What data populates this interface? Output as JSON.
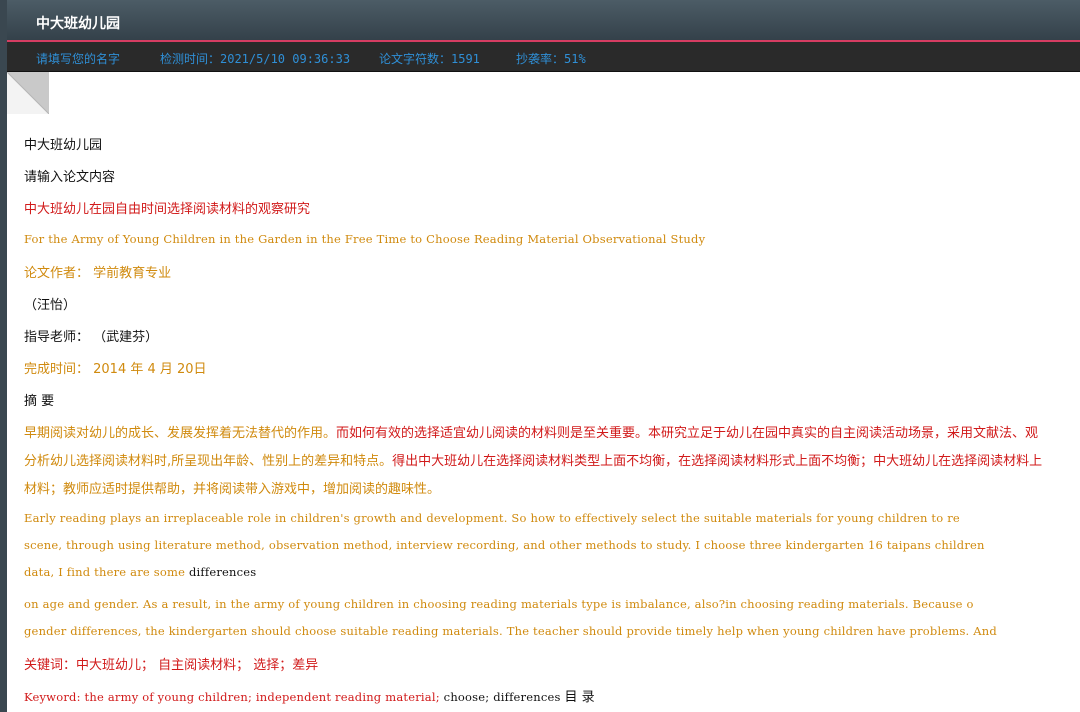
{
  "window": {
    "title": "中大班幼儿园"
  },
  "infobar": {
    "name_prompt": "请填写您的名字",
    "check_time": "检测时间：2021/5/10 09:36:33",
    "char_count": "论文字符数：1591",
    "plagiarism_rate": "抄袭率：51%"
  },
  "document": {
    "lines": [
      "中大班幼儿园",
      "请输入论文内容",
      "中大班幼儿在园自由时间选择阅读材料的观察研究",
      "For the Army of Young Children in the Garden in the Free Time to Choose Reading Material Observational Study",
      "论文作者： 学前教育专业",
      "（汪怡）",
      "指导老师：  （武建芬）",
      "完成时间： 2014 年 4 月 20日",
      "摘 要",
      "早期阅读对幼儿的成长、发展发挥着无法替代的作用。",
      "而如何有效的选择适宜幼儿阅读的材料则是至关重要。本研究立足于幼儿在园中真实的自主阅读活动场景，采用文献法、观",
      "分析幼儿选择阅读材料时,所呈现出年龄、性别上的差异和特点。",
      "得出中大班幼儿在选择阅读材料类型上面不均衡，在选择阅读材料形式上面不均衡；中大班幼儿在选择阅读材料上",
      "材料；教师应适时提供帮助，并将阅读带入游戏中，增加阅读的趣味性。",
      "Early reading plays an irreplaceable role in children's growth and development. So how to effectively select the suitable materials for young children to re",
      "scene, through using literature method, observation method, interview recording, and other methods to study. I choose three kindergarten 16 taipans children",
      "data, I find there are some ",
      "differences",
      "on age and gender. As a result, in the army of young children in choosing reading materials type is imbalance, also?in choosing reading materials. Because o",
      "gender differences, the kindergarten should choose suitable reading materials. The teacher should provide timely help when young children have problems. And",
      "关键词：中大班幼儿；  自主阅读材料；  选择；差异",
      "Keyword: the army of young children; independent reading material; ",
      "choose; differences ",
      "目 录"
    ]
  },
  "colors": {
    "black": "#111111",
    "red": "#d11a1a",
    "orange": "#d08a0e",
    "info_blue": "#2f8fd6",
    "accent_line": "#d63d62"
  },
  "icons": {
    "page_fold": "page-fold-icon"
  }
}
